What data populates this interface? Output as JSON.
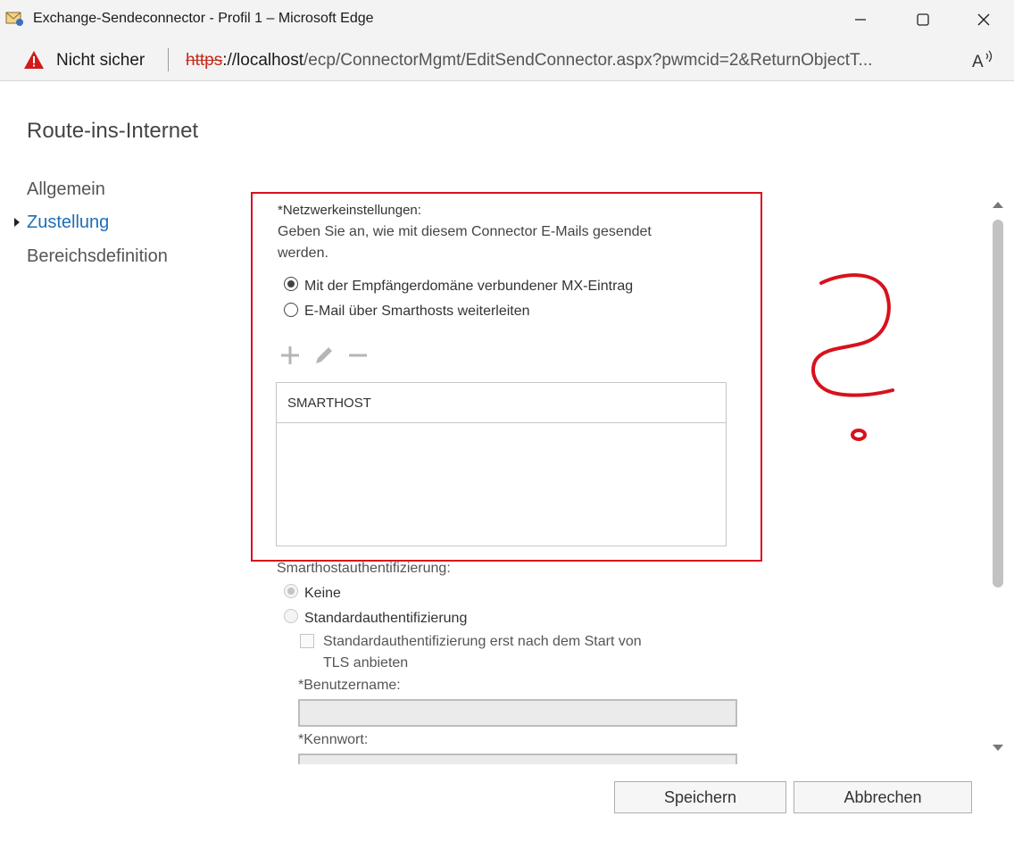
{
  "window": {
    "title": "Exchange-Sendeconnector - Profil 1 – Microsoft Edge",
    "icons": [
      "exchange-envelope-icon",
      "minimize-icon",
      "maximize-icon",
      "close-icon"
    ]
  },
  "address_bar": {
    "security_label": "Nicht sicher",
    "url_protocol": "https",
    "url_host": "://localhost",
    "url_path": "/ecp/ConnectorMgmt/EditSendConnector.aspx?pwmcid=2&ReturnObjectT...",
    "icons": [
      "warning-icon",
      "read-aloud-icon"
    ]
  },
  "page": {
    "title": "Route-ins-Internet"
  },
  "nav": {
    "items": [
      {
        "label": "Allgemein",
        "active": false
      },
      {
        "label": "Zustellung",
        "active": true
      },
      {
        "label": "Bereichsdefinition",
        "active": false
      }
    ]
  },
  "network": {
    "heading": "*Netzwerkeinstellungen:",
    "description_line1": "Geben Sie an, wie mit diesem Connector E-Mails gesendet",
    "description_line2": "werden.",
    "options": [
      {
        "label": "Mit der Empfängerdomäne verbundener MX-Eintrag",
        "checked": true
      },
      {
        "label": "E-Mail über Smarthosts weiterleiten",
        "checked": false
      }
    ],
    "toolbar_icons": [
      "add-icon",
      "edit-icon",
      "remove-icon"
    ],
    "table": {
      "columns": [
        "SMARTHOST"
      ],
      "rows": []
    }
  },
  "auth": {
    "heading": "Smarthostauthentifizierung:",
    "options": [
      {
        "label": "Keine",
        "checked": true,
        "disabled": true
      },
      {
        "label": "Standardauthentifizierung",
        "checked": false,
        "disabled": true
      }
    ],
    "tls_checkbox_line1": "Standardauthentifizierung erst nach dem Start von",
    "tls_checkbox_line2": "TLS anbieten",
    "username_label": "*Benutzername:",
    "username_value": "",
    "password_label": "*Kennwort:",
    "password_value": ""
  },
  "buttons": {
    "save": "Speichern",
    "cancel": "Abbrechen"
  },
  "colors": {
    "accent_link": "#1e6fb5",
    "highlight_border": "#d8111d",
    "warning": "#c42b1c"
  }
}
